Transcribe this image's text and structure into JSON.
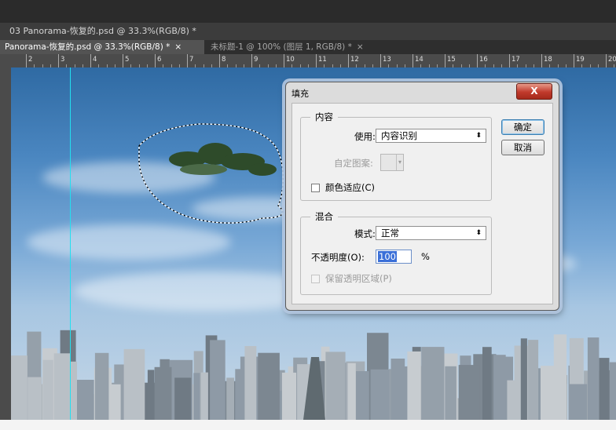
{
  "window": {
    "title": "03 Panorama-恢复的.psd @ 33.3%(RGB/8) *"
  },
  "tabs": [
    {
      "label": "Panorama-恢复的.psd @ 33.3%(RGB/8) *",
      "close": "×"
    },
    {
      "label": "未标题-1 @ 100% (图层 1, RGB/8) *",
      "close": "×"
    }
  ],
  "ruler": {
    "labels": [
      "2",
      "3",
      "4",
      "5",
      "6",
      "7",
      "8",
      "9",
      "10",
      "11",
      "12",
      "13",
      "14",
      "15",
      "16",
      "17",
      "18",
      "19",
      "20",
      "21"
    ]
  },
  "dialog": {
    "title": "填充",
    "close_label": "X",
    "contents": {
      "legend": "内容",
      "use_label": "使用:",
      "use_value": "内容识别",
      "pattern_label": "自定图案:",
      "color_adapt_label": "颜色适应(C)"
    },
    "blending": {
      "legend": "混合",
      "mode_label": "模式:",
      "mode_value": "正常",
      "opacity_label": "不透明度(O):",
      "opacity_value": "100",
      "opacity_unit": "%",
      "preserve_label": "保留透明区域(P)"
    },
    "buttons": {
      "ok": "确定",
      "cancel": "取消"
    }
  },
  "colors": {
    "guide": "#22e0f0",
    "close_button": "#c0392b",
    "selection_highlight": "#3a6fd8"
  }
}
